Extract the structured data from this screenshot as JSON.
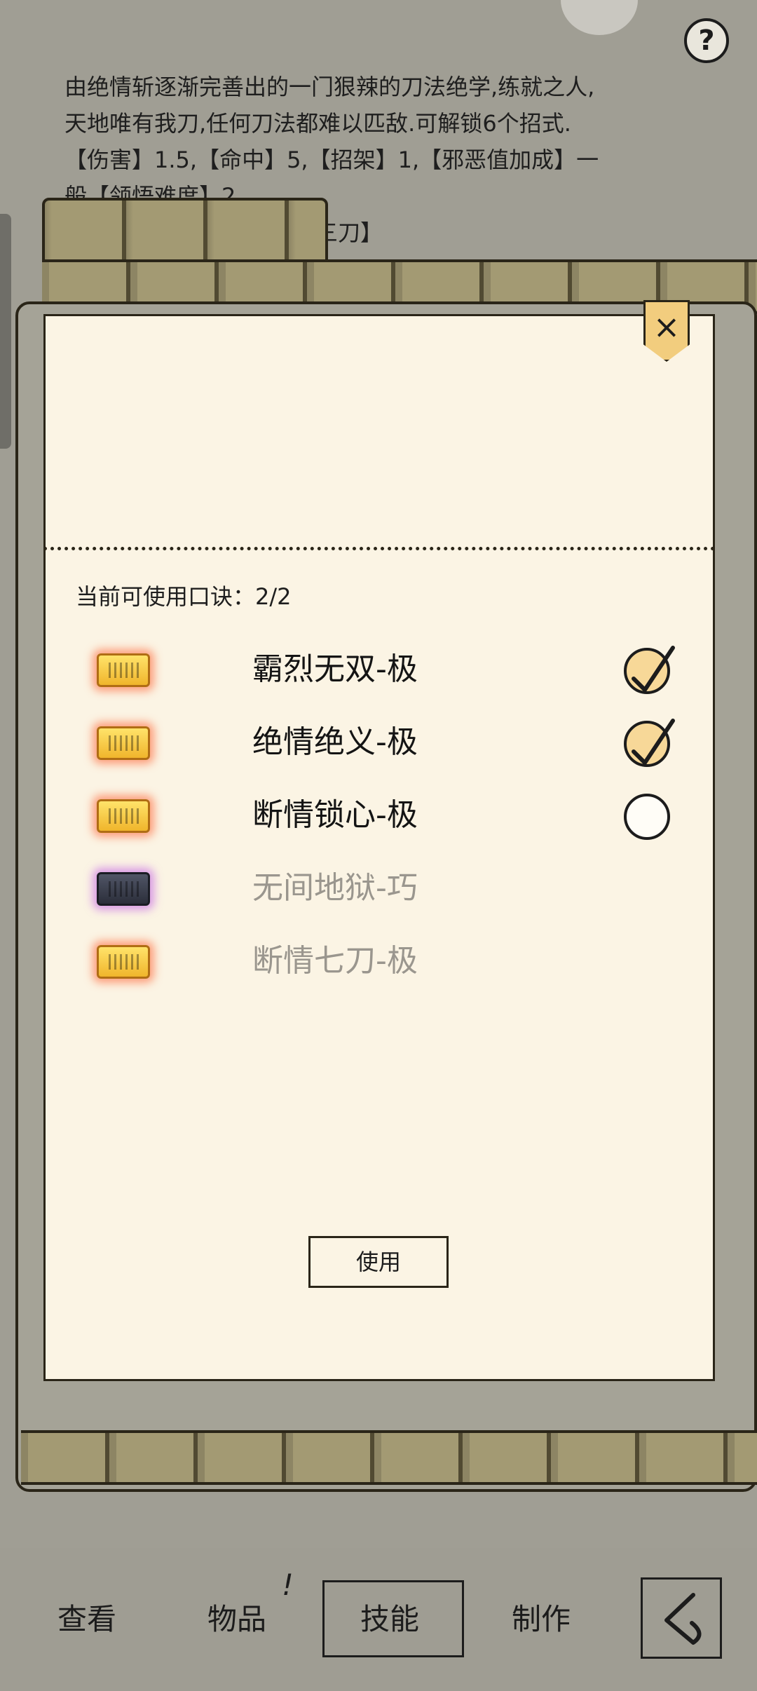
{
  "description": {
    "lines": [
      "由绝情斩逐渐完善出的一门狠辣的刀法绝学,练就之人,",
      "天地唯有我刀,任何刀法都难以匹敌.可解锁6个招式.",
      "【伤害】1.5,【命中】5,【招架】1,【邪恶值加成】一",
      "般【领悟难度】2",
      "情斩】【阿鼻道三刀】"
    ]
  },
  "help_label": "?",
  "dialog": {
    "close_label": "×",
    "count_text": "当前可使用口诀：2/2",
    "skills": [
      {
        "name": "霸烈无双-极",
        "enabled": true,
        "checked": true,
        "icon": "gold-scroll-icon"
      },
      {
        "name": "绝情绝义-极",
        "enabled": true,
        "checked": true,
        "icon": "gold-scroll-icon"
      },
      {
        "name": "断情锁心-极",
        "enabled": true,
        "checked": false,
        "icon": "gold-scroll-icon"
      },
      {
        "name": "无间地狱-巧",
        "enabled": false,
        "checked": null,
        "icon": "dark-scroll-icon"
      },
      {
        "name": "断情七刀-极",
        "enabled": false,
        "checked": null,
        "icon": "gold-scroll-icon"
      }
    ],
    "use_button": "使用"
  },
  "bottom_nav": {
    "tabs": [
      "查看",
      "物品",
      "技能",
      "制作"
    ],
    "selected": "技能",
    "badge": "!"
  },
  "colors": {
    "modal_bg": "#fbf4e4",
    "check_on": "#f7d898",
    "disabled_text": "#9a968e"
  }
}
